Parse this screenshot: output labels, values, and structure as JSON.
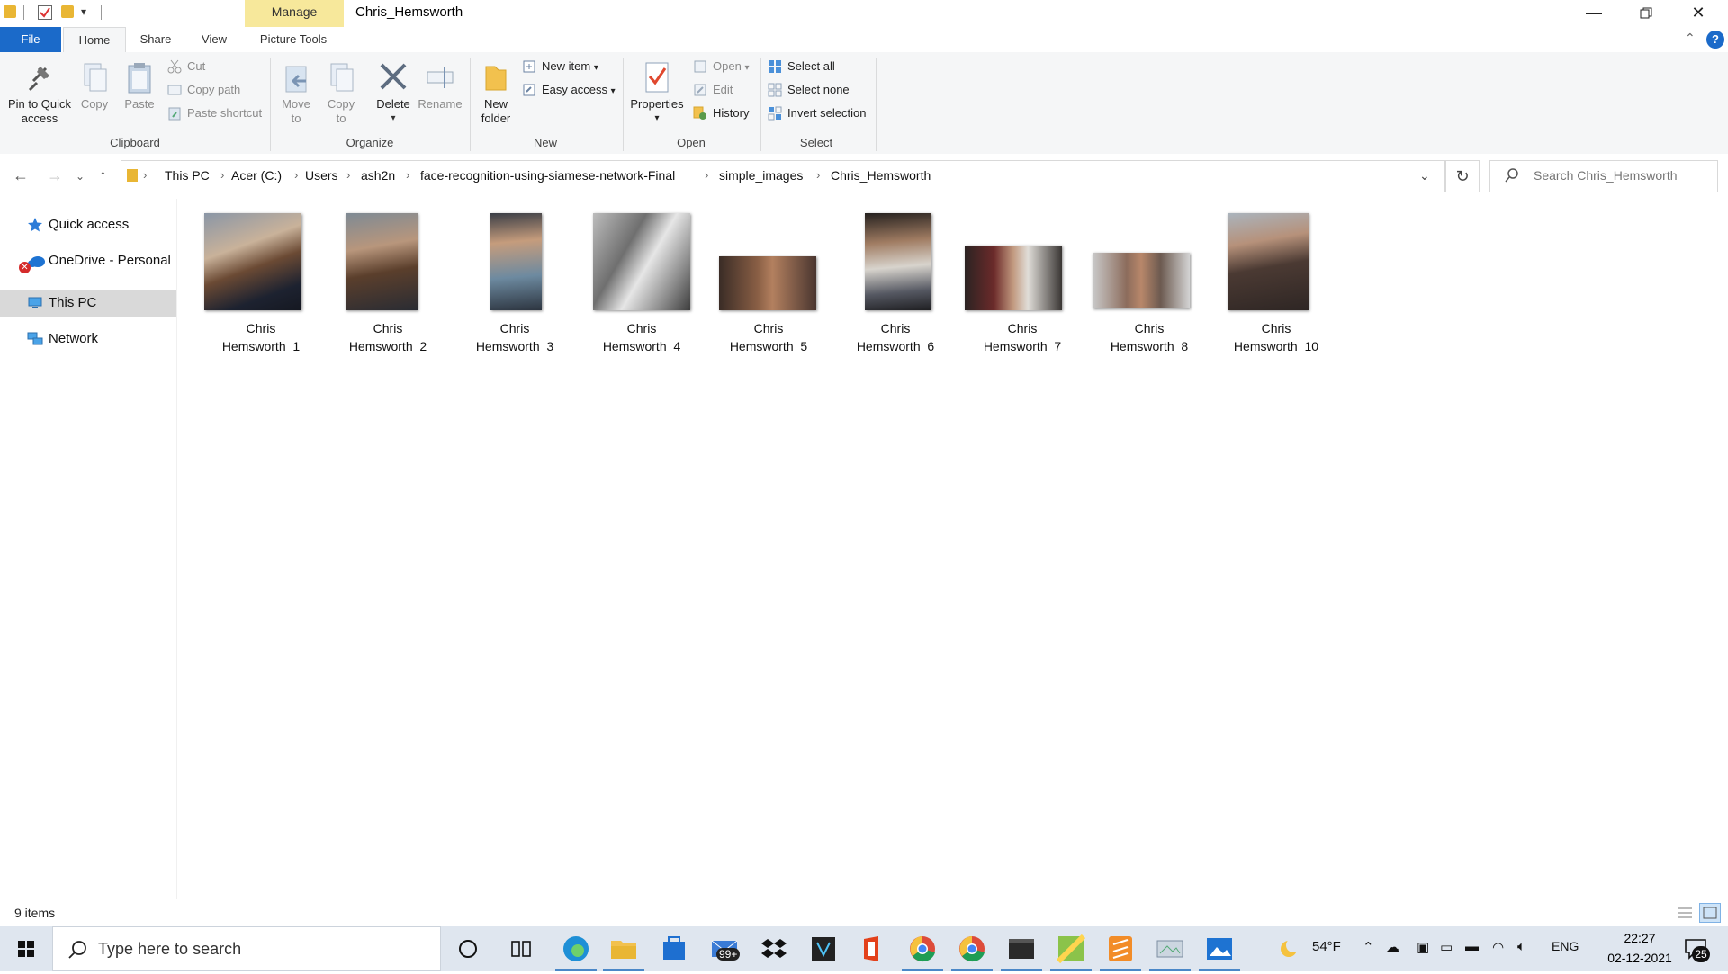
{
  "window": {
    "title": "Chris_Hemsworth",
    "manage_tab": "Manage",
    "picture_tools_tab": "Picture Tools"
  },
  "tabs": [
    "File",
    "Home",
    "Share",
    "View"
  ],
  "ribbon": {
    "clipboard": {
      "label": "Clipboard",
      "pin": "Pin to Quick access",
      "pin_l1": "Pin to Quick",
      "pin_l2": "access",
      "copy": "Copy",
      "paste": "Paste",
      "cut": "Cut",
      "copy_path": "Copy path",
      "paste_shortcut": "Paste shortcut"
    },
    "organize": {
      "label": "Organize",
      "move_l1": "Move",
      "move_l2": "to",
      "copy_l1": "Copy",
      "copy_l2": "to",
      "delete": "Delete",
      "rename": "Rename"
    },
    "new": {
      "label": "New",
      "folder_l1": "New",
      "folder_l2": "folder",
      "new_item": "New item",
      "easy_access": "Easy access"
    },
    "open": {
      "label": "Open",
      "properties": "Properties",
      "open": "Open",
      "edit": "Edit",
      "history": "History"
    },
    "select": {
      "label": "Select",
      "select_all": "Select all",
      "select_none": "Select none",
      "invert": "Invert selection"
    }
  },
  "address": {
    "crumbs": [
      "This PC",
      "Acer (C:)",
      "Users",
      "ash2n",
      "face-recognition-using-siamese-network-Final",
      "simple_images",
      "Chris_Hemsworth"
    ]
  },
  "search": {
    "placeholder": "Search Chris_Hemsworth"
  },
  "sidebar": {
    "items": [
      {
        "label": "Quick access"
      },
      {
        "label": "OneDrive - Personal"
      },
      {
        "label": "This PC"
      },
      {
        "label": "Network"
      }
    ]
  },
  "files": [
    {
      "l1": "Chris",
      "l2": "Hemsworth_1"
    },
    {
      "l1": "Chris",
      "l2": "Hemsworth_2"
    },
    {
      "l1": "Chris",
      "l2": "Hemsworth_3"
    },
    {
      "l1": "Chris",
      "l2": "Hemsworth_4"
    },
    {
      "l1": "Chris",
      "l2": "Hemsworth_5"
    },
    {
      "l1": "Chris",
      "l2": "Hemsworth_6"
    },
    {
      "l1": "Chris",
      "l2": "Hemsworth_7"
    },
    {
      "l1": "Chris",
      "l2": "Hemsworth_8"
    },
    {
      "l1": "Chris",
      "l2": "Hemsworth_10"
    }
  ],
  "status": {
    "item_count": "9 items"
  },
  "taskbar": {
    "search_text": "Type here to search",
    "mail_badge": "99+",
    "weather": "54°F",
    "language": "ENG",
    "time": "22:27",
    "date": "02-12-2021",
    "notification_count": "25"
  }
}
